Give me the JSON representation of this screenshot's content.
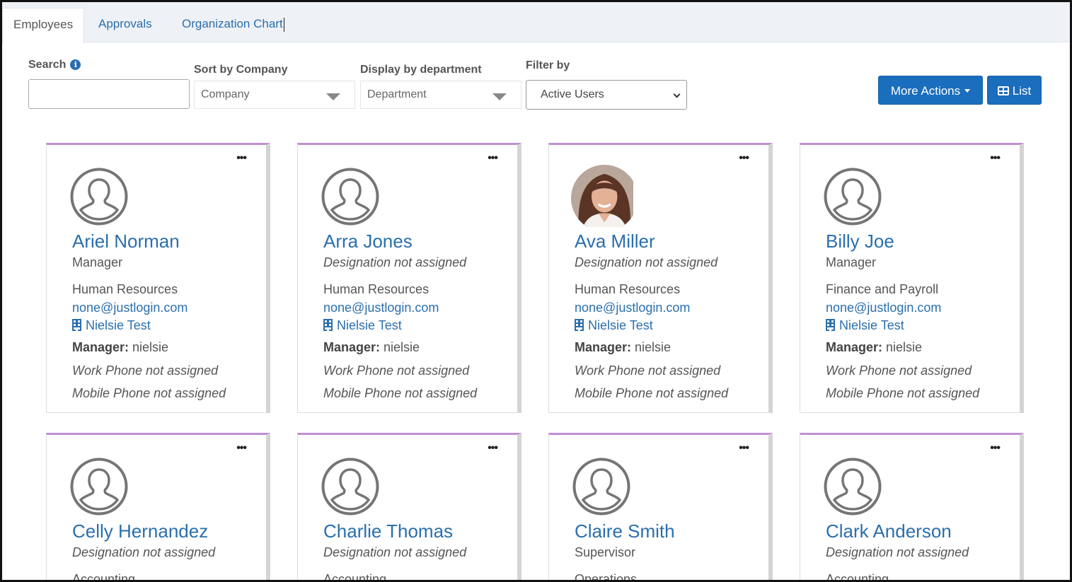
{
  "tabs": [
    {
      "label": "Employees",
      "active": true
    },
    {
      "label": "Approvals",
      "active": false
    },
    {
      "label": "Organization Chart",
      "active": false
    }
  ],
  "filters": {
    "search_label": "Search",
    "search_value": "",
    "sort_label": "Sort by Company",
    "sort_placeholder": "Company",
    "department_label": "Display by department",
    "department_placeholder": "Department",
    "filter_label": "Filter by",
    "filter_value": "Active Users"
  },
  "actions": {
    "more_actions": "More Actions",
    "list": "List"
  },
  "employees": [
    {
      "name": "Ariel Norman",
      "designation": "Manager",
      "department": "Human Resources",
      "email": "none@justlogin.com",
      "company": "Nielsie Test",
      "manager_label": "Manager:",
      "manager": "nielsie",
      "work_phone": "Work Phone not assigned",
      "mobile_phone": "Mobile Phone not assigned"
    },
    {
      "name": "Arra Jones",
      "designation": "Designation not assigned",
      "department": "Human Resources",
      "email": "none@justlogin.com",
      "company": "Nielsie Test",
      "manager_label": "Manager:",
      "manager": "nielsie",
      "work_phone": "Work Phone not assigned",
      "mobile_phone": "Mobile Phone not assigned"
    },
    {
      "name": "Ava Miller",
      "designation": "Designation not assigned",
      "department": "Human Resources",
      "email": "none@justlogin.com",
      "company": "Nielsie Test",
      "manager_label": "Manager:",
      "manager": "nielsie",
      "work_phone": "Work Phone not assigned",
      "mobile_phone": "Mobile Phone not assigned"
    },
    {
      "name": "Billy Joe",
      "designation": "Manager",
      "department": "Finance and Payroll",
      "email": "none@justlogin.com",
      "company": "Nielsie Test",
      "manager_label": "Manager:",
      "manager": "nielsie",
      "work_phone": "Work Phone not assigned",
      "mobile_phone": "Mobile Phone not assigned"
    },
    {
      "name": "Celly Hernandez",
      "designation": "Designation not assigned",
      "department": "Accounting"
    },
    {
      "name": "Charlie Thomas",
      "designation": "Designation not assigned",
      "department": "Accounting"
    },
    {
      "name": "Claire Smith",
      "designation": "Supervisor",
      "department": "Operations"
    },
    {
      "name": "Clark Anderson",
      "designation": "Designation not assigned",
      "department": "Accounting"
    }
  ],
  "colors": {
    "accent": "#1b6dbe",
    "link": "#2a6fad",
    "card_top_border": "#c08fd2"
  }
}
